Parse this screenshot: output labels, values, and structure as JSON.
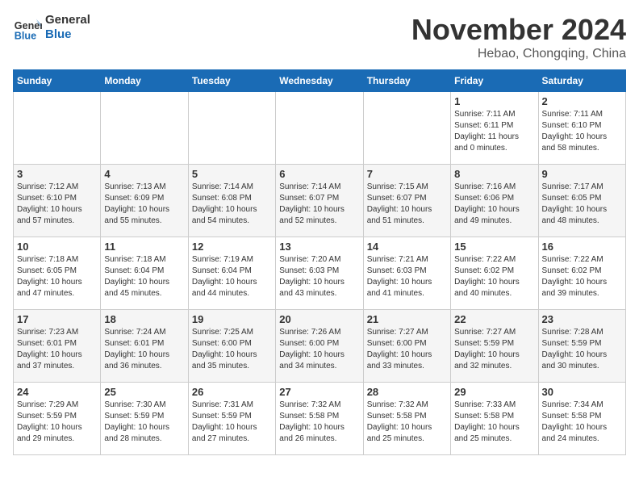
{
  "logo": {
    "line1": "General",
    "line2": "Blue"
  },
  "title": "November 2024",
  "subtitle": "Hebao, Chongqing, China",
  "weekdays": [
    "Sunday",
    "Monday",
    "Tuesday",
    "Wednesday",
    "Thursday",
    "Friday",
    "Saturday"
  ],
  "weeks": [
    [
      {
        "day": "",
        "info": ""
      },
      {
        "day": "",
        "info": ""
      },
      {
        "day": "",
        "info": ""
      },
      {
        "day": "",
        "info": ""
      },
      {
        "day": "",
        "info": ""
      },
      {
        "day": "1",
        "info": "Sunrise: 7:11 AM\nSunset: 6:11 PM\nDaylight: 11 hours\nand 0 minutes."
      },
      {
        "day": "2",
        "info": "Sunrise: 7:11 AM\nSunset: 6:10 PM\nDaylight: 10 hours\nand 58 minutes."
      }
    ],
    [
      {
        "day": "3",
        "info": "Sunrise: 7:12 AM\nSunset: 6:10 PM\nDaylight: 10 hours\nand 57 minutes."
      },
      {
        "day": "4",
        "info": "Sunrise: 7:13 AM\nSunset: 6:09 PM\nDaylight: 10 hours\nand 55 minutes."
      },
      {
        "day": "5",
        "info": "Sunrise: 7:14 AM\nSunset: 6:08 PM\nDaylight: 10 hours\nand 54 minutes."
      },
      {
        "day": "6",
        "info": "Sunrise: 7:14 AM\nSunset: 6:07 PM\nDaylight: 10 hours\nand 52 minutes."
      },
      {
        "day": "7",
        "info": "Sunrise: 7:15 AM\nSunset: 6:07 PM\nDaylight: 10 hours\nand 51 minutes."
      },
      {
        "day": "8",
        "info": "Sunrise: 7:16 AM\nSunset: 6:06 PM\nDaylight: 10 hours\nand 49 minutes."
      },
      {
        "day": "9",
        "info": "Sunrise: 7:17 AM\nSunset: 6:05 PM\nDaylight: 10 hours\nand 48 minutes."
      }
    ],
    [
      {
        "day": "10",
        "info": "Sunrise: 7:18 AM\nSunset: 6:05 PM\nDaylight: 10 hours\nand 47 minutes."
      },
      {
        "day": "11",
        "info": "Sunrise: 7:18 AM\nSunset: 6:04 PM\nDaylight: 10 hours\nand 45 minutes."
      },
      {
        "day": "12",
        "info": "Sunrise: 7:19 AM\nSunset: 6:04 PM\nDaylight: 10 hours\nand 44 minutes."
      },
      {
        "day": "13",
        "info": "Sunrise: 7:20 AM\nSunset: 6:03 PM\nDaylight: 10 hours\nand 43 minutes."
      },
      {
        "day": "14",
        "info": "Sunrise: 7:21 AM\nSunset: 6:03 PM\nDaylight: 10 hours\nand 41 minutes."
      },
      {
        "day": "15",
        "info": "Sunrise: 7:22 AM\nSunset: 6:02 PM\nDaylight: 10 hours\nand 40 minutes."
      },
      {
        "day": "16",
        "info": "Sunrise: 7:22 AM\nSunset: 6:02 PM\nDaylight: 10 hours\nand 39 minutes."
      }
    ],
    [
      {
        "day": "17",
        "info": "Sunrise: 7:23 AM\nSunset: 6:01 PM\nDaylight: 10 hours\nand 37 minutes."
      },
      {
        "day": "18",
        "info": "Sunrise: 7:24 AM\nSunset: 6:01 PM\nDaylight: 10 hours\nand 36 minutes."
      },
      {
        "day": "19",
        "info": "Sunrise: 7:25 AM\nSunset: 6:00 PM\nDaylight: 10 hours\nand 35 minutes."
      },
      {
        "day": "20",
        "info": "Sunrise: 7:26 AM\nSunset: 6:00 PM\nDaylight: 10 hours\nand 34 minutes."
      },
      {
        "day": "21",
        "info": "Sunrise: 7:27 AM\nSunset: 6:00 PM\nDaylight: 10 hours\nand 33 minutes."
      },
      {
        "day": "22",
        "info": "Sunrise: 7:27 AM\nSunset: 5:59 PM\nDaylight: 10 hours\nand 32 minutes."
      },
      {
        "day": "23",
        "info": "Sunrise: 7:28 AM\nSunset: 5:59 PM\nDaylight: 10 hours\nand 30 minutes."
      }
    ],
    [
      {
        "day": "24",
        "info": "Sunrise: 7:29 AM\nSunset: 5:59 PM\nDaylight: 10 hours\nand 29 minutes."
      },
      {
        "day": "25",
        "info": "Sunrise: 7:30 AM\nSunset: 5:59 PM\nDaylight: 10 hours\nand 28 minutes."
      },
      {
        "day": "26",
        "info": "Sunrise: 7:31 AM\nSunset: 5:59 PM\nDaylight: 10 hours\nand 27 minutes."
      },
      {
        "day": "27",
        "info": "Sunrise: 7:32 AM\nSunset: 5:58 PM\nDaylight: 10 hours\nand 26 minutes."
      },
      {
        "day": "28",
        "info": "Sunrise: 7:32 AM\nSunset: 5:58 PM\nDaylight: 10 hours\nand 25 minutes."
      },
      {
        "day": "29",
        "info": "Sunrise: 7:33 AM\nSunset: 5:58 PM\nDaylight: 10 hours\nand 25 minutes."
      },
      {
        "day": "30",
        "info": "Sunrise: 7:34 AM\nSunset: 5:58 PM\nDaylight: 10 hours\nand 24 minutes."
      }
    ]
  ]
}
